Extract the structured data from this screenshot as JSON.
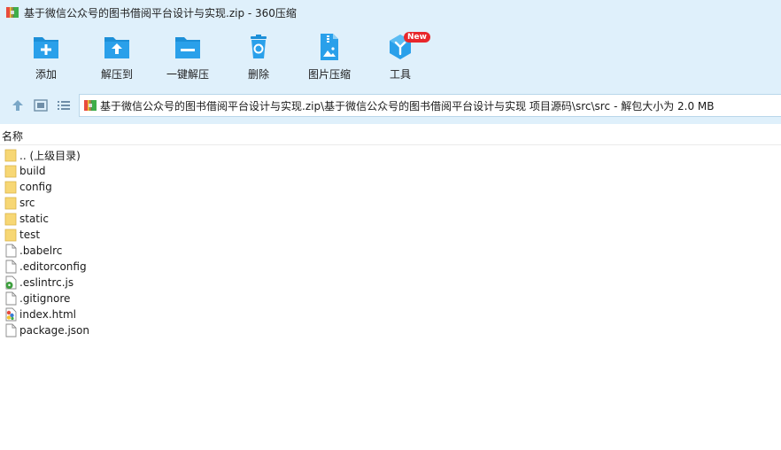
{
  "window": {
    "title": "基于微信公众号的图书借阅平台设计与实现.zip - 360压缩"
  },
  "toolbar": {
    "items": [
      {
        "label": "添加",
        "icon": "add-icon"
      },
      {
        "label": "解压到",
        "icon": "extract-to-icon"
      },
      {
        "label": "一键解压",
        "icon": "one-click-extract-icon"
      },
      {
        "label": "删除",
        "icon": "delete-icon"
      },
      {
        "label": "图片压缩",
        "icon": "image-compress-icon"
      },
      {
        "label": "工具",
        "icon": "tools-icon",
        "badge": "New"
      }
    ]
  },
  "address": {
    "path": "基于微信公众号的图书借阅平台设计与实现.zip\\基于微信公众号的图书借阅平台设计与实现 项目源码\\src\\src",
    "size_info": "- 解包大小为 2.0 MB"
  },
  "list": {
    "header_name": "名称",
    "files": [
      {
        "name": ".. (上级目录)",
        "type": "folder"
      },
      {
        "name": "build",
        "type": "folder"
      },
      {
        "name": "config",
        "type": "folder"
      },
      {
        "name": "src",
        "type": "folder"
      },
      {
        "name": "static",
        "type": "folder"
      },
      {
        "name": "test",
        "type": "folder"
      },
      {
        "name": ".babelrc",
        "type": "file"
      },
      {
        "name": ".editorconfig",
        "type": "file"
      },
      {
        "name": ".eslintrc.js",
        "type": "js"
      },
      {
        "name": ".gitignore",
        "type": "file"
      },
      {
        "name": "index.html",
        "type": "html"
      },
      {
        "name": "package.json",
        "type": "file"
      }
    ]
  },
  "colors": {
    "chrome_bg": "#dff0fb",
    "icon_blue": "#1c8fd8",
    "badge_red": "#e8272b",
    "folder_yellow": "#f7d774"
  }
}
